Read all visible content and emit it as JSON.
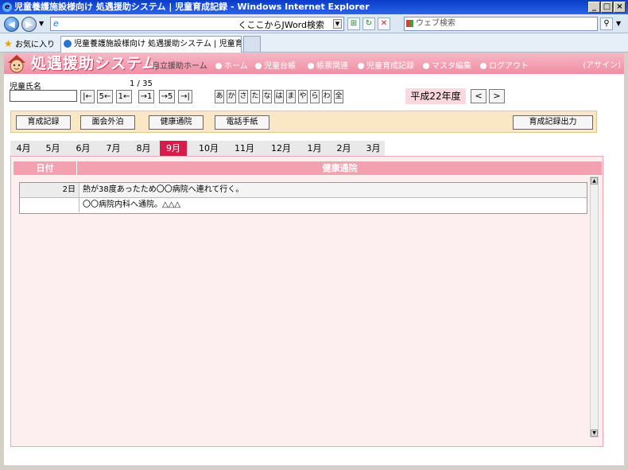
{
  "window": {
    "title": "児童養護施設様向け 処遇援助システム | 児童育成記録 - Windows Internet Explorer"
  },
  "browser": {
    "address_text": "くここからJWord検索",
    "search_placeholder": "ウェブ検索",
    "favorites_label": "お気に入り",
    "tab_title": "児童養護施設様向け 処遇援助システム | 児童育成..."
  },
  "app": {
    "title": "処遇援助システム",
    "subtitle": "自立援助ホーム",
    "nav": [
      "ホーム",
      "児童台帳",
      "帳票関連",
      "児童育成記録",
      "マスタ編集",
      "ログアウト"
    ],
    "assign": "(アサイン)"
  },
  "child": {
    "name_label": "児童氏名",
    "name_value": "",
    "counter": "1 / 35",
    "nav_buttons": [
      "|←",
      "5←",
      "1←",
      "→1",
      "→5",
      "→|"
    ],
    "kana": [
      "あ",
      "か",
      "さ",
      "た",
      "な",
      "は",
      "ま",
      "や",
      "ら",
      "わ",
      "全"
    ]
  },
  "fiscal": {
    "label": "平成22年度",
    "prev": "<",
    "next": ">"
  },
  "commands": {
    "ikusei": "育成記録",
    "menkai": "面会外泊",
    "kenko": "健康通院",
    "denwa": "電話手紙",
    "output": "育成記録出力"
  },
  "months": [
    "4月",
    "5月",
    "6月",
    "7月",
    "8月",
    "9月",
    "10月",
    "11月",
    "12月",
    "1月",
    "2月",
    "3月"
  ],
  "selected_month": "9月",
  "table": {
    "header_date": "日付",
    "header_body": "健康通院",
    "rows": [
      {
        "date": "2日",
        "text": "熱が38度あったため〇〇病院へ連れて行く。"
      },
      {
        "date": "",
        "text": "〇〇病院内科へ通院。△△△"
      }
    ]
  }
}
